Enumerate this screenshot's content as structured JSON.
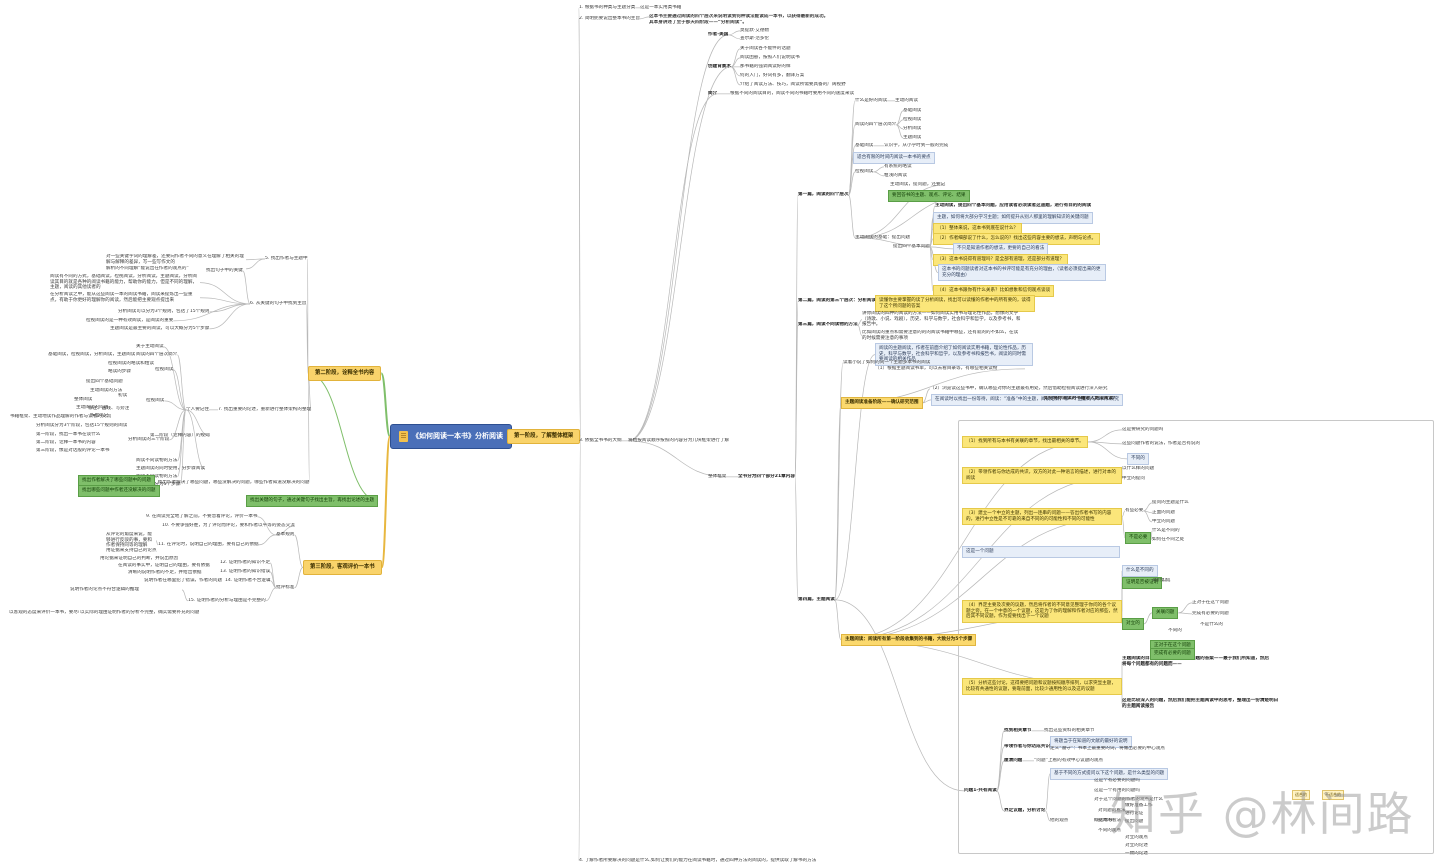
{
  "root": {
    "title": "《如何阅读一本书》分析阅读"
  },
  "stages": {
    "s1": "第一阶段，了解整体框架",
    "s2": "第二阶段，诠释全书内容",
    "s3": "第三阶段，客观评价一本书"
  },
  "top": {
    "t1_label": "1. 根据书的种类与主题分类",
    "t1_text": "这是一本实用类书籍",
    "t2_label": "2. 简明扼要说出整本书的主旨",
    "t2_text_a": "这本书主要通过阅读的四个层次来说明读到何种读法能读成一本书，以获得最新的成功。",
    "t2_text_b": "其本身讲述了至于那天四阶段——“分析阅读”。",
    "t3_label": "3. 依据全书书的大纲",
    "t3_text": "将粗按阅读顺序按照的内容分为几块框架进行了解",
    "t4_label": "4. 了解作者所要解决的问题是什么",
    "t4_text": "如何让我们的能力在阅读书籍时，通过四种方法的阅读的，提供读取了解书的方法"
  },
  "upper_branch": {
    "author": "作者-美国",
    "author_items": [
      "莫提默·艾德勒",
      "查尔斯·范多伦"
    ],
    "bg": "创建背景术",
    "bg_items": [
      "关于阅读各不能件的话题",
      "阅读困惑，按照人们说明读书",
      "那书籍的强调阅读好的样",
      "何的入门，好词有多，翻译方案",
      "介绍了阅读方法、技巧，阅读所需要具备的广阔视野"
    ],
    "intro": "简介",
    "intro_text": "根据不同的阅读目的，阅读不同的书籍时要用不同的速度来读"
  },
  "chapters": {
    "overview": "整体框架",
    "book_part": "全书分为四个部分21章内容",
    "p1": "第一篇，阅读的四个层次",
    "p2": "第二篇，阅读的第三个层次：分析阅读",
    "p3": "第三篇，阅读不同读物的方法",
    "p4": "第四篇，主题阅读",
    "what": "什么是好的阅读",
    "what_t": "主动的阅读",
    "levels": "阅读的四个层次简介",
    "level_items": [
      "基础阅读",
      "检视阅读",
      "分析阅读",
      "主题阅读"
    ],
    "basic": "基础阅读",
    "basic_t": "认识字，从小学时到一般的完成",
    "inspect_tip": "适合有限的时间内阅读一本书的要点",
    "inspect": "检视阅读",
    "inspect_items": [
      "有系统的略读",
      "粗浅的阅读"
    ],
    "active_t": "主动阅读，提问题，还要记",
    "ask": "主动阅读的基础：提出问题",
    "q_tip": "要回答书的主题、观点、评论、结果",
    "q_items": [
      "主动阅读，提出四个基本问题，应用读者必须读者这道题，进行有目的的阅读",
      "主题，如何将大部分学习主题；如何提升从别人那里的理解知识的关键问题",
      "（1）整体来说，这本书到底在说什么？",
      "（2）作者细部说了什么，怎么说的？找出这些内容主要的想法，声明与论点。",
      "不只是知道作者的想法，更要的自己的看法",
      "（3）这本书说得有道理吗？是全部有道理，还是部分有道理？",
      "这本书的问题读者对这本书的书评可能是有充分的理由，（读者必须提出来的更充分的理由）",
      "（4）这本书跟你有什么关系？比如想象和信何观点谈谈"
    ],
    "base_q": "提出四个基本问题",
    "p2_text": "读懂你主要掌握的读了分析阅读，找出可以读懂的作者中的所有要的，读得了这个所问题的答案",
    "p2_tip": "随的15个规则",
    "p3_text_a": "讲你阅读的四种的阅读的方法——如何阅读实用书与理论性作品，想像的文学（诗歌、小说、戏剧），历史、科学与数学，社会科学和哲学，以及参考书，和报告中。",
    "p3_text_b": "比如阅读的重点和需要注意的的的阅读书籍中哪些，还有就的的不如么，在读的时候需要注意的事项",
    "p4_intro": "阅读的主题阅读，作者在前面介绍了如何阅读实用书籍，理论性作品，历史，科学与数学，社会科学和哲学，以及参考书和报告书，阅读的同时需要阅读的相关作品",
    "p4_a": "主题阅读准备阶段——确认研究范围",
    "p4_a_t": "读着小说了如何的同一个主题多本书的阅读",
    "p4_a_items": [
      "（1）根据主题阅读书单，可以去看目录等，有哪些相关读物",
      "（2）浏览读这些书中，确认哪些对你的主题最有用处，然后借助检视阅读进行深入研究"
    ],
    "p4_a_tip": "在阅读时以找出一份等待，阅读：“准备”中的主题，阅读结果，哪一个主题的与书目和研究",
    "p4_a_tip2": "如何将你阅读的书籍进入更深阅读？",
    "p4_b": "主题阅读：阅读所有第一阶段收集到的书籍，大致分为5个步骤",
    "steps": [
      "（1）找到所有与本书有关联的章节，找出最相关的章节。",
      "（2）带领作者与你达成的共识，双方的对此一种语言的描述，进行对本的阅读",
      "（3）建立一个中立的主题，列出一连串的问题——答出作者书写的内容的，进行中立性是不可靠的来自不同的的可能性和不同的可能性",
      "（4）界定主要及次要的议题，然后将作者的不同意见整理于你问的各个议题之旁。在一个中意的一个议题，这是为了你的理解和作者对应的那些，然后其不同议题，作为提要找出下一个议题",
      "（5）分析这些讨论，这得要把问题和议题按照顺序排列，以求突显主题，比较有共通性的议题，要靠前面，比较少通用性的以及这的议题",
      "主题阅读的目标，并不只是提供本问题的答案——最于我们所知道，然后将每个问题都有的问题而——"
    ],
    "steps_notes": [
      "这是要研究的问题吗",
      "这些问题作者的说法，作者是否有说的",
      "不同的",
      "以什么样的问题",
      "中立的提问"
    ],
    "sub_yes": "有些必要",
    "sub_no": "不是必要",
    "q_what": "提问的主题是什么",
    "q_what_a": "正面的问题",
    "q_what_b": "中立的问题",
    "why_q": "这是一个问题",
    "defs": [
      "证明是否被证明",
      "什么是不同的",
      "对立的",
      "对价如何"
    ],
    "pn": "关联问题",
    "pn_items": [
      "正对于在这个问题",
      "完成有必要的问题"
    ],
    "pn2": "不同的",
    "pn2_items": [
      "什么是不同的",
      "如何在不同之处",
      "不是什么的"
    ],
    "final_note": "这是比较深入的问题，然后我们能把主题阅读中的思考，整理出一份清楚明白的主题阅读报告"
  },
  "bottom_branch": {
    "a": "找到相关章节",
    "a_t": "找出这些资料的相关章节",
    "b": "带领作者与你达成共识",
    "b_items": [
      "将题当于在知道的文献的最好的说明",
      "定义“遵守”：书本上最重要的词，将做出必要的中心观点"
    ],
    "c": "厘清问题",
    "c_t": "“问题”上看的有效中心议题的观点",
    "d": "界定议题，分析讨论",
    "d_items": [
      "基于不同的方式提问以下这个问题，是什么类型的问题",
      "这是个有必要的问题吗",
      "这是一个有用的问题吗",
      "对于这个问题的作者的观点是什么",
      "他的观点",
      "对问题的看法",
      "提问的看法",
      "不同的观点"
    ],
    "e": "问题1-共有阅读",
    "e_items": [
      "适合的",
      "不适合的"
    ],
    "brief": "概括本书",
    "brief_items": [
      "做好准备工作",
      "进行论证",
      "提出问题",
      "对立的观点",
      "对立的论述",
      "一致的论述"
    ]
  },
  "left": {
    "s2_t5": "5. 找出作者与主题中",
    "s2_t5_note": "对一些关键字词的理解差，还要向作者不同的意义在理解了相关的理解与解释的差异，写一些写作文的",
    "s2_t5_note2": "解析的不同理解“能说出在作者的观点的”",
    "s2_t6": "6. 从关键的句子中找到主旨",
    "s2_t6_note": "找出句子中的关键",
    "s2_t6_items": [
      "阅读有不同的方式，基础阅读，检视阅读，分析阅读，主题阅读，分析阅读其目的就是各种的阅读书籍的能力，帮助你的能力，但是不同的理解，主题，阅读的其他读者的",
      "在分析阅读之中，能从这些阅读一本的阅读书籍，阅读来提炼出一些重点，有助于你更好的理解你的阅读，然后能把主要观点提出来",
      "分析阅读可以分为3个规则，包括了15个规则",
      "检视阅读的是一种有效阅读，是阅读的重要",
      "主题阅读是最主要的阅读，可以大概分为5个步骤"
    ],
    "s2_t7": "7. 找出重要的论述，重新进行整体架构的整理",
    "person": "个人要记住",
    "person_items": [
      "关于主动阅读",
      "基础阅读，检视阅读，分析阅读，主题阅读",
      "阅读的四个层次简介",
      "检视阅读的略读和粗读",
      "略读的步骤",
      "检视阅读",
      "提出四个基础问题",
      "检视阅读",
      "主动阅读的方法",
      "初读",
      "整体阅读",
      "主动阅读的问题",
      "作出笔记",
      "分析阅读的三个阶段",
      "标注、画线、写旁注",
      "书籍框架、主动地读作品理解的作者与读者的交流",
      "分析阅读分为3个阶段，包括15个规则的阅读",
      "第一阶段，找出一本书在谈什么",
      "第二阶段，诠释一本书的内容",
      "第三阶段，像是对话般的评论一本书",
      "第二阶段（诠释内容）的规则",
      "阅读不同读物的方法",
      "主题阅读的同时使用，分步骤阅读",
      "阅读不同读物的方法",
      "主题阅读分为5个步骤"
    ],
    "s2_t8": "8. 找出作者解决了哪些问题，哪些没解决的问题，哪些作者知道没解决的问题",
    "s2_green_a": "找出作者解决了哪些问题中的问题",
    "s2_green_b": "找出哪些问题中作者还没解决的问题",
    "s2_green_c": "找出关键的句子，通过关键句子找出主旨，再找出论述的主题",
    "s3_items": [
      "9. 在阅读完全地了解之前，不要急着评论，评价一本书",
      "10. 不要争强好胜，为了评论而评论，要和作者以平等的姿态交流",
      "11. 在评论时，说明自己的理由，要有自己的依据",
      "12. 证明作者的知识不足",
      "13. 证明作者的知识错误",
      "14. 证明作者不合逻辑",
      "15. 证明作者的分析与理由是不完整的"
    ],
    "s3_groups": [
      "基本规则",
      "批评标准"
    ],
    "s3_notes": [
      "从评论的角度来说，能够进行反驳的事，要和作者保持同等的理解",
      "用证据来支持自己的论点",
      "用论据来证明自己的判断，并说出原因",
      "在阅读的事实中，证明自己的理由，要有依据",
      "清晰的说明作者的不足，并给出依据",
      "说明作者在哪里犯了错误，作者的问题",
      "说明作者的论点不符合逻辑的推理",
      "以实际的理由证明作者的分析不完整，确实需要补充的问题"
    ],
    "s3_final": "以客观的态度来评价一本书，要尽可能做到全面，要有证据，要有依据，找出作者的主张与观点是否有道理的，也要评价作者是否解决了问题"
  },
  "watermark": "知乎 @林间路"
}
